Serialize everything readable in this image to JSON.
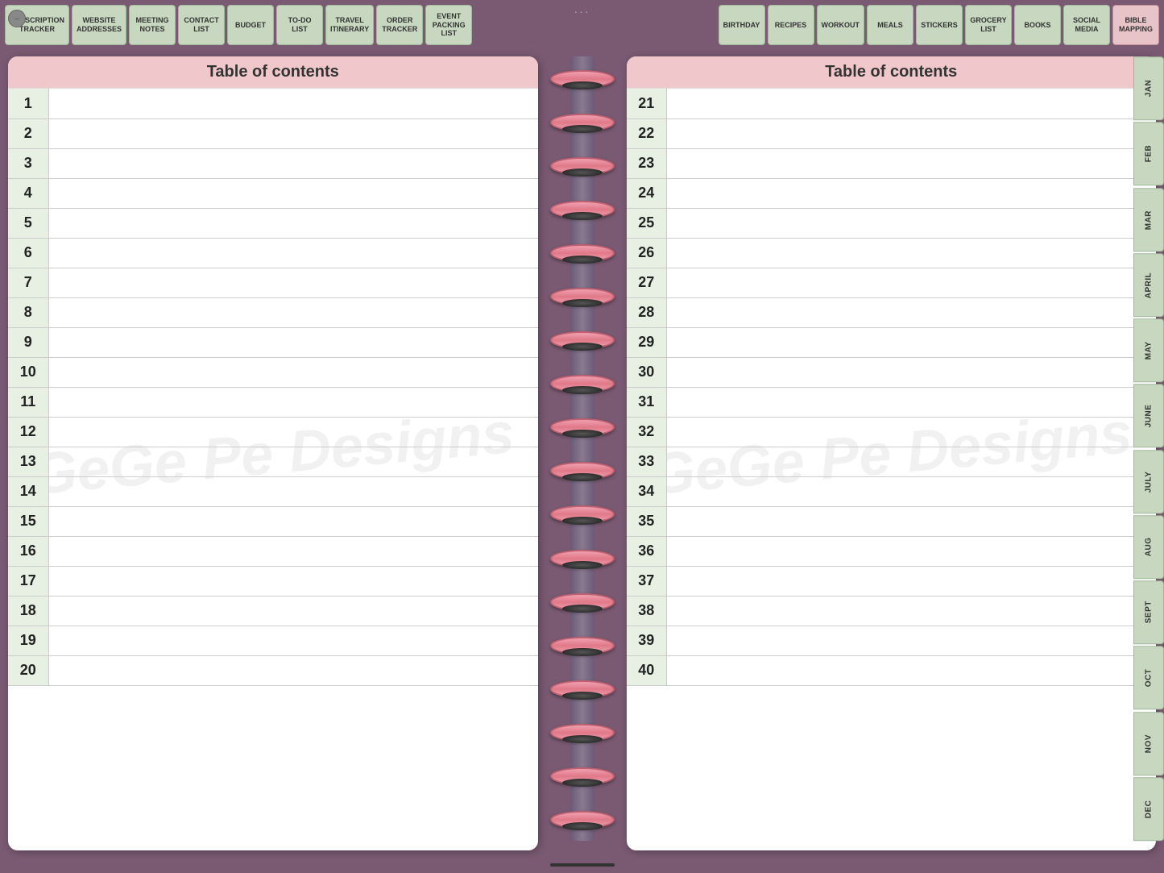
{
  "window": {
    "controls": [
      "–",
      "□",
      "×"
    ],
    "drag_dots": "···"
  },
  "top_nav_left": [
    {
      "label": "SUBSCRIPTION\nTRACKER",
      "active": false
    },
    {
      "label": "WEBSITE\nADDRESSES",
      "active": false
    },
    {
      "label": "MEETING\nNOTES",
      "active": false
    },
    {
      "label": "CONTACT\nLIST",
      "active": false
    },
    {
      "label": "Budget",
      "active": false
    },
    {
      "label": "TO-DO\nLIST",
      "active": false
    },
    {
      "label": "TRAVEL\nITINERARY",
      "active": false
    },
    {
      "label": "Order\nTracker",
      "active": false
    },
    {
      "label": "EVENT\nPACKING\nLIST",
      "active": false
    }
  ],
  "top_nav_right": [
    {
      "label": "BIRTHDAY",
      "active": false
    },
    {
      "label": "Recipes",
      "active": false
    },
    {
      "label": "WORKOUT",
      "active": false
    },
    {
      "label": "MEALS",
      "active": false
    },
    {
      "label": "STICKERS",
      "active": false
    },
    {
      "label": "GROCERY\nLIST",
      "active": false
    },
    {
      "label": "BOOKS",
      "active": false
    },
    {
      "label": "SOCIAL\nMEDIA",
      "active": false
    },
    {
      "label": "BIBLE\nMAPPING",
      "active": true
    }
  ],
  "pages": {
    "left": {
      "title": "Table of contents",
      "watermark": "GeGe Pe    Designs",
      "rows": [
        {
          "num": "1",
          "content": ""
        },
        {
          "num": "2",
          "content": ""
        },
        {
          "num": "3",
          "content": ""
        },
        {
          "num": "4",
          "content": ""
        },
        {
          "num": "5",
          "content": ""
        },
        {
          "num": "6",
          "content": ""
        },
        {
          "num": "7",
          "content": ""
        },
        {
          "num": "8",
          "content": ""
        },
        {
          "num": "9",
          "content": ""
        },
        {
          "num": "10",
          "content": ""
        },
        {
          "num": "11",
          "content": ""
        },
        {
          "num": "12",
          "content": ""
        },
        {
          "num": "13",
          "content": ""
        },
        {
          "num": "14",
          "content": ""
        },
        {
          "num": "15",
          "content": ""
        },
        {
          "num": "16",
          "content": ""
        },
        {
          "num": "17",
          "content": ""
        },
        {
          "num": "18",
          "content": ""
        },
        {
          "num": "19",
          "content": ""
        },
        {
          "num": "20",
          "content": ""
        }
      ]
    },
    "right": {
      "title": "Table of contents",
      "watermark": "GeGe Pe    Designs",
      "rows": [
        {
          "num": "21",
          "content": ""
        },
        {
          "num": "22",
          "content": ""
        },
        {
          "num": "23",
          "content": ""
        },
        {
          "num": "24",
          "content": ""
        },
        {
          "num": "25",
          "content": ""
        },
        {
          "num": "26",
          "content": ""
        },
        {
          "num": "27",
          "content": ""
        },
        {
          "num": "28",
          "content": ""
        },
        {
          "num": "29",
          "content": ""
        },
        {
          "num": "30",
          "content": ""
        },
        {
          "num": "31",
          "content": ""
        },
        {
          "num": "32",
          "content": ""
        },
        {
          "num": "33",
          "content": ""
        },
        {
          "num": "34",
          "content": ""
        },
        {
          "num": "35",
          "content": ""
        },
        {
          "num": "36",
          "content": ""
        },
        {
          "num": "37",
          "content": ""
        },
        {
          "num": "38",
          "content": ""
        },
        {
          "num": "39",
          "content": ""
        },
        {
          "num": "40",
          "content": ""
        }
      ]
    }
  },
  "right_sidebar_tabs": [
    {
      "label": "JAN"
    },
    {
      "label": "FEB"
    },
    {
      "label": "MAR"
    },
    {
      "label": "APRIL"
    },
    {
      "label": "MAY"
    },
    {
      "label": "JUNE"
    },
    {
      "label": "JULY"
    },
    {
      "label": "AUG"
    },
    {
      "label": "SEPT"
    },
    {
      "label": "OCT"
    },
    {
      "label": "NOV"
    },
    {
      "label": "DEC"
    }
  ]
}
